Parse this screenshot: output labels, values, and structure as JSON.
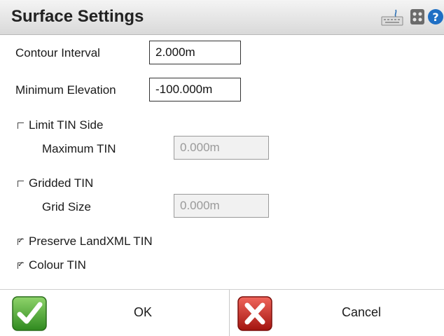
{
  "window": {
    "title": "Surface Settings"
  },
  "titlebar_icons": [
    "keyboard-icon",
    "app-grid-icon",
    "help-icon"
  ],
  "contour_interval": {
    "label": "Contour Interval",
    "value": "2.000m"
  },
  "minimum_elevation": {
    "label": "Minimum Elevation",
    "value": "-100.000m"
  },
  "limit_tin_side": {
    "label": "Limit TIN Side",
    "checked": false,
    "maximum_tin": {
      "label": "Maximum TIN",
      "value": "0.000m",
      "enabled": false
    }
  },
  "gridded_tin": {
    "label": "Gridded TIN",
    "checked": false,
    "grid_size": {
      "label": "Grid Size",
      "value": "0.000m",
      "enabled": false
    }
  },
  "preserve_landxml_tin": {
    "label": "Preserve LandXML TIN",
    "checked": true
  },
  "colour_tin": {
    "label": "Colour TIN",
    "checked": true
  },
  "footer": {
    "ok_label": "OK",
    "cancel_label": "Cancel",
    "ok_color": "#3a9a2a",
    "cancel_color": "#c7201c"
  }
}
